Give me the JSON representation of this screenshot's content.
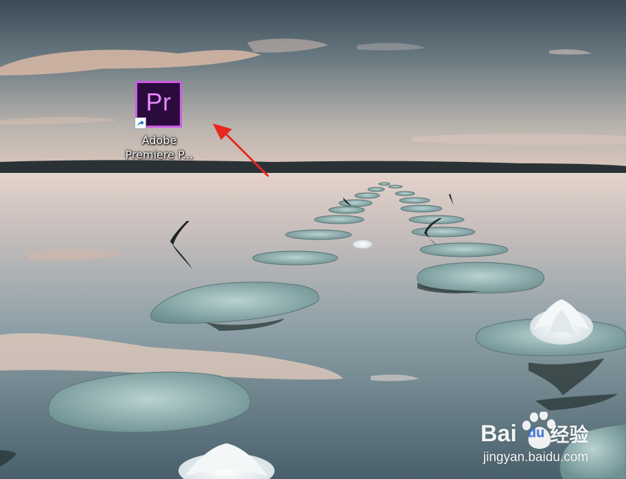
{
  "desktop": {
    "icons": [
      {
        "name": "Adobe Premiere Pro shortcut",
        "app_glyph": "Pr",
        "label_line1": "Adobe",
        "label_line2": "Premiere P...",
        "icon": "premiere-pro-icon",
        "badge_icon": "shortcut-arrow-icon",
        "tile_color": "#2b0a3d",
        "tile_accent": "#cd5ce6"
      }
    ],
    "annotation": {
      "type": "arrow",
      "color": "#e8281e",
      "points_to": "Adobe Premiere Pro shortcut"
    }
  },
  "watermark": {
    "brand_left": "Bai",
    "brand_mark": "du",
    "brand_right": "经验",
    "url": "jingyan.baidu.com"
  }
}
